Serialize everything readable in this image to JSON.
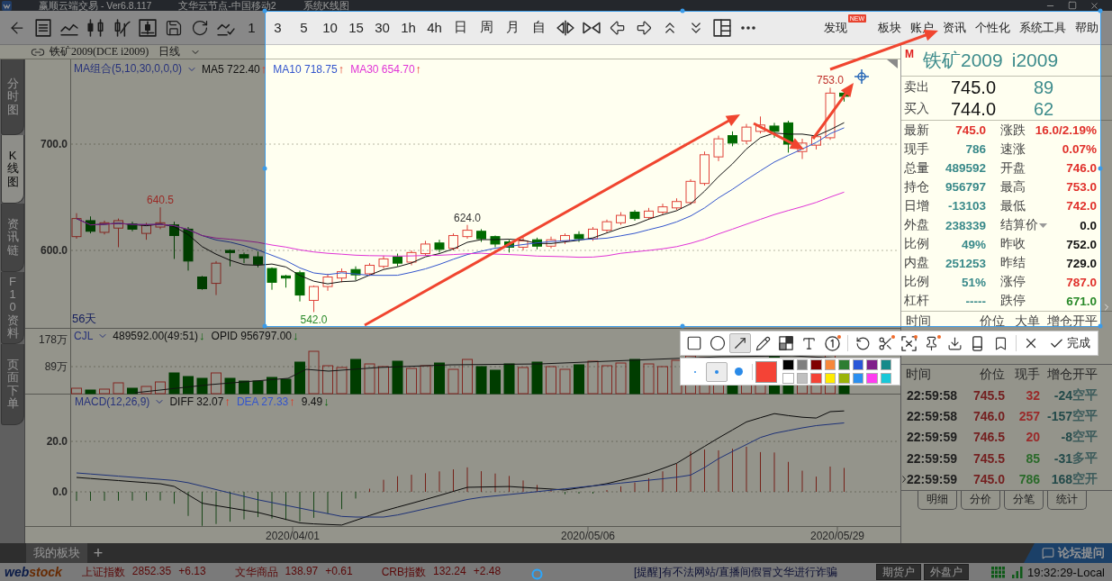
{
  "title_bar": {
    "segments": [
      "赢顺云端交易 - Ver6.8.117",
      "文华云节点-中国移动2",
      "系统K线图"
    ]
  },
  "toolbar": {
    "periods": [
      "1",
      "3",
      "5",
      "10",
      "15",
      "30",
      "1h",
      "4h",
      "日",
      "周",
      "月",
      "自"
    ],
    "menu": [
      {
        "label": "发现",
        "badge": "NEW"
      },
      {
        "label": "板块"
      },
      {
        "label": "账户"
      },
      {
        "label": "资讯"
      },
      {
        "label": "个性化"
      },
      {
        "label": "系统工具"
      },
      {
        "label": "帮助"
      }
    ]
  },
  "symbol_bar": {
    "symbol": "铁矿2009(DCE i2009)",
    "period": "日线"
  },
  "side_tabs": [
    {
      "label": "分时图",
      "selected": false
    },
    {
      "label": "K线图",
      "selected": true
    },
    {
      "label": "资讯链",
      "selected": false
    },
    {
      "label": "F10资料",
      "selected": false
    },
    {
      "label": "页面下单",
      "selected": false
    }
  ],
  "price_panel": {
    "indicator": "MA组合(5,10,30,0,0,0)",
    "readings": [
      {
        "text": "MA5 722.40",
        "arrow": "↑",
        "kind": "up",
        "color": "#111111"
      },
      {
        "text": "MA10 718.75",
        "arrow": "↑",
        "kind": "up",
        "color": "#3355cc"
      },
      {
        "text": "MA30 654.70",
        "arrow": "↑",
        "kind": "up",
        "color": "#e033d6"
      }
    ],
    "axis_labels": [
      "700.0",
      "600.0"
    ],
    "annotations": [
      {
        "text": "640.5",
        "color": "#9a2a25"
      },
      {
        "text": "542.0",
        "color": "#2a8a2a"
      },
      {
        "text": "624.0",
        "color": "#333333"
      },
      {
        "text": "753.0",
        "color": "#c0302a"
      }
    ],
    "span": "56天"
  },
  "volume_panel": {
    "indicator": "CJL",
    "readings": [
      {
        "text": "489592.00(49:51)",
        "arrow": "↓",
        "kind": "down",
        "color": "#111111"
      },
      {
        "text": "OPID 956797.00",
        "arrow": "↓",
        "kind": "down",
        "color": "#111111"
      }
    ],
    "axis_labels": [
      "178万",
      "89万"
    ]
  },
  "macd_panel": {
    "indicator": "MACD(12,26,9)",
    "readings": [
      {
        "text": "DIFF 32.07",
        "arrow": "↑",
        "kind": "up",
        "color": "#111111"
      },
      {
        "text": "DEA 27.33",
        "arrow": "↑",
        "kind": "up",
        "color": "#3355cc"
      },
      {
        "text": "9.49",
        "arrow": "↓",
        "kind": "down",
        "color": "#111111"
      }
    ],
    "axis_labels": [
      "20.0",
      "0.0"
    ]
  },
  "date_axis": [
    "2020/04/01",
    "2020/05/06",
    "2020/05/29"
  ],
  "quote": {
    "market": "M",
    "name": "铁矿2009",
    "code": "i2009",
    "book": [
      {
        "label": "卖出",
        "price": "745.0",
        "volume": "89"
      },
      {
        "label": "买入",
        "price": "744.0",
        "volume": "62"
      }
    ],
    "stats": [
      {
        "label": "最新",
        "value": "745.0",
        "color": "#e0302a",
        "dropdown": false
      },
      {
        "label": "涨跌",
        "value": "16.0/2.19%",
        "color": "#e0302a",
        "dropdown": false
      },
      {
        "label": "现手",
        "value": "786",
        "color": "#3a8a8a",
        "dropdown": false
      },
      {
        "label": "速涨",
        "value": "0.07%",
        "color": "#e0302a",
        "dropdown": false
      },
      {
        "label": "总量",
        "value": "489592",
        "color": "#3a8a8a",
        "dropdown": false
      },
      {
        "label": "开盘",
        "value": "746.0",
        "color": "#e0302a",
        "dropdown": false
      },
      {
        "label": "持仓",
        "value": "956797",
        "color": "#3a8a8a",
        "dropdown": false
      },
      {
        "label": "最高",
        "value": "753.0",
        "color": "#e0302a",
        "dropdown": false
      },
      {
        "label": "日增",
        "value": "-13103",
        "color": "#3a8a8a",
        "dropdown": false
      },
      {
        "label": "最低",
        "value": "742.0",
        "color": "#e0302a",
        "dropdown": false
      },
      {
        "label": "外盘",
        "value": "238339",
        "color": "#3a8a8a",
        "dropdown": false
      },
      {
        "label": "结算价",
        "value": "0.0",
        "color": "#111111",
        "dropdown": true
      },
      {
        "label": "比例",
        "value": "49%",
        "color": "#3a8a8a",
        "dropdown": false
      },
      {
        "label": "昨收",
        "value": "752.0",
        "color": "#111111",
        "dropdown": false
      },
      {
        "label": "内盘",
        "value": "251253",
        "color": "#3a8a8a",
        "dropdown": false
      },
      {
        "label": "昨结",
        "value": "729.0",
        "color": "#111111",
        "dropdown": false
      },
      {
        "label": "比例",
        "value": "51%",
        "color": "#3a8a8a",
        "dropdown": false
      },
      {
        "label": "涨停",
        "value": "787.0",
        "color": "#e0302a",
        "dropdown": false
      },
      {
        "label": "杠杆",
        "value": "-----",
        "color": "#3a8a8a",
        "dropdown": false
      },
      {
        "label": "跌停",
        "value": "671.0",
        "color": "#2a8a2a",
        "dropdown": false
      }
    ]
  },
  "big_orders": {
    "columns": [
      "时间",
      "价位",
      "大单",
      "增仓",
      "开平"
    ]
  },
  "ticks": {
    "columns": [
      "时间",
      "价位",
      "现手",
      "增仓",
      "开平"
    ],
    "rows": [
      {
        "time": "22:59:58",
        "price": "745.5",
        "volume": "32",
        "color": "#9a2a2a",
        "change": "-24",
        "action": "空平",
        "current": false
      },
      {
        "time": "22:59:58",
        "price": "746.0",
        "volume": "257",
        "color": "#9a2a2a",
        "change": "-157",
        "action": "空平",
        "current": false
      },
      {
        "time": "22:59:59",
        "price": "746.5",
        "volume": "20",
        "color": "#9a2a2a",
        "change": "-8",
        "action": "空平",
        "current": false
      },
      {
        "time": "22:59:59",
        "price": "745.5",
        "volume": "85",
        "color": "#2a6a2a",
        "change": "-31",
        "action": "多平",
        "current": false
      },
      {
        "time": "22:59:59",
        "price": "745.0",
        "volume": "786",
        "color": "#2a6a2a",
        "change": "168",
        "action": "空开",
        "current": true
      }
    ]
  },
  "detail_tabs": [
    "明细",
    "分价",
    "分笔",
    "统计"
  ],
  "drawing_toolbar": {
    "tool_groups": [
      [
        {
          "kind": "rectangle",
          "selected": false,
          "badge": false
        },
        {
          "kind": "ellipse",
          "selected": false,
          "badge": false
        },
        {
          "kind": "arrow",
          "selected": true,
          "badge": false
        },
        {
          "kind": "pencil",
          "selected": false,
          "badge": false
        },
        {
          "kind": "mosaic",
          "selected": false,
          "badge": false
        },
        {
          "kind": "text",
          "selected": false,
          "badge": false
        },
        {
          "kind": "number",
          "selected": false,
          "badge": true
        }
      ],
      [
        {
          "kind": "undo",
          "selected": false,
          "badge": false
        },
        {
          "kind": "cut",
          "selected": false,
          "badge": true
        },
        {
          "kind": "expand",
          "selected": false,
          "badge": true
        },
        {
          "kind": "pin",
          "selected": false,
          "badge": true
        },
        {
          "kind": "download",
          "selected": false,
          "badge": false
        },
        {
          "kind": "phone",
          "selected": false,
          "badge": false
        },
        {
          "kind": "bookmark",
          "selected": false,
          "badge": false
        }
      ]
    ],
    "done": "完成"
  },
  "palette": {
    "sizes": [
      {
        "kind": "small",
        "selected": false
      },
      {
        "kind": "medium",
        "selected": true
      },
      {
        "kind": "large",
        "selected": false
      }
    ],
    "current": {
      "color": "#f44336"
    },
    "swatches": [
      {
        "color": "#000000"
      },
      {
        "color": "#808080"
      },
      {
        "color": "#800000"
      },
      {
        "color": "#f7883a"
      },
      {
        "color": "#2e7d32"
      },
      {
        "color": "#2856d8"
      },
      {
        "color": "#80208a"
      },
      {
        "color": "#158a8a"
      },
      {
        "color": "#ffffff"
      },
      {
        "color": "#c0c0c0"
      },
      {
        "color": "#f44336"
      },
      {
        "color": "#ffeb00"
      },
      {
        "color": "#9ab40a"
      },
      {
        "color": "#2b8ff0"
      },
      {
        "color": "#ff3df0"
      },
      {
        "color": "#19c8d8"
      }
    ]
  },
  "board_bar": {
    "tabs": [
      {
        "label": "我的板块"
      }
    ],
    "add": "+",
    "forum": "论坛提问"
  },
  "ticker": {
    "logo": [
      "web",
      "stock"
    ],
    "indices": [
      {
        "name": "上证指数",
        "value": "2852.35",
        "change": "+6.13"
      },
      {
        "name": "文华商品",
        "value": "138.97",
        "change": "+0.61"
      },
      {
        "name": "CRB指数",
        "value": "132.24",
        "change": "+2.48"
      }
    ],
    "notice": "[提醒]有不法网站/直播间假冒文华进行诈骗",
    "accounts": [
      "期货户",
      "外盘户"
    ],
    "clock": "19:32:29-Local"
  }
}
